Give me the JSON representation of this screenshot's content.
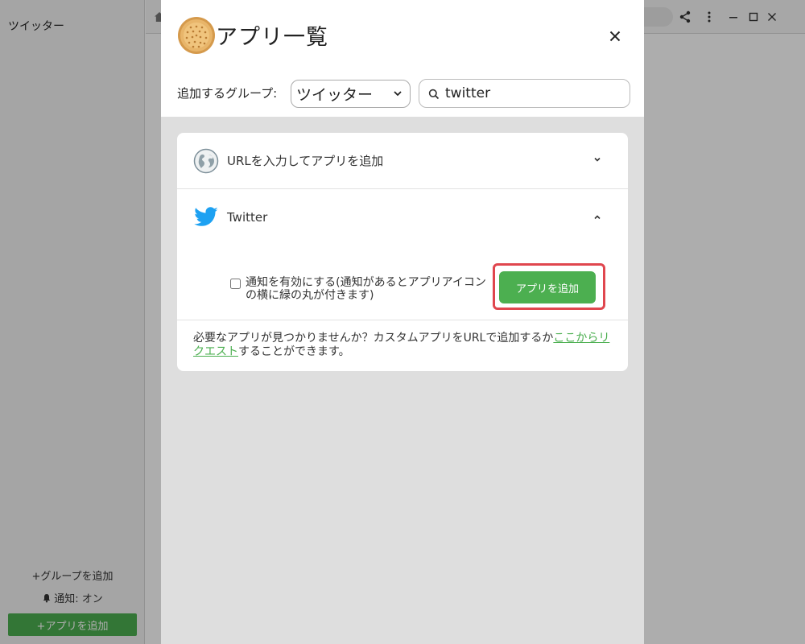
{
  "sidebar": {
    "title": "ツイッター",
    "add_group": "+グループを追加",
    "notify_label": "通知: オン",
    "add_app": "+アプリを追加"
  },
  "topbar": {
    "icons": [
      "home-icon",
      "share-icon",
      "more-vert-icon",
      "minimize-icon",
      "maximize-icon",
      "close-icon"
    ]
  },
  "modal": {
    "title": "アプリ一覧",
    "group_label": "追加するグループ:",
    "group_value": "ツイッター",
    "search_value": "twitter",
    "apps": [
      {
        "label": "URLを入力してアプリを追加",
        "expanded": false
      },
      {
        "label": "Twitter",
        "expanded": true
      }
    ],
    "notify_checkbox_label": "通知を有効にする(通知があるとアプリアイコンの横に緑の丸が付きます)",
    "add_button": "アプリを追加",
    "footer_prefix": "必要なアプリが見つかりませんか？カスタムアプリをURLで追加するか",
    "footer_link": "ここからリクエスト",
    "footer_suffix": "することができます。"
  },
  "colors": {
    "accent": "#4caf50",
    "highlight": "#e0464e",
    "twitter": "#1da1f2"
  }
}
